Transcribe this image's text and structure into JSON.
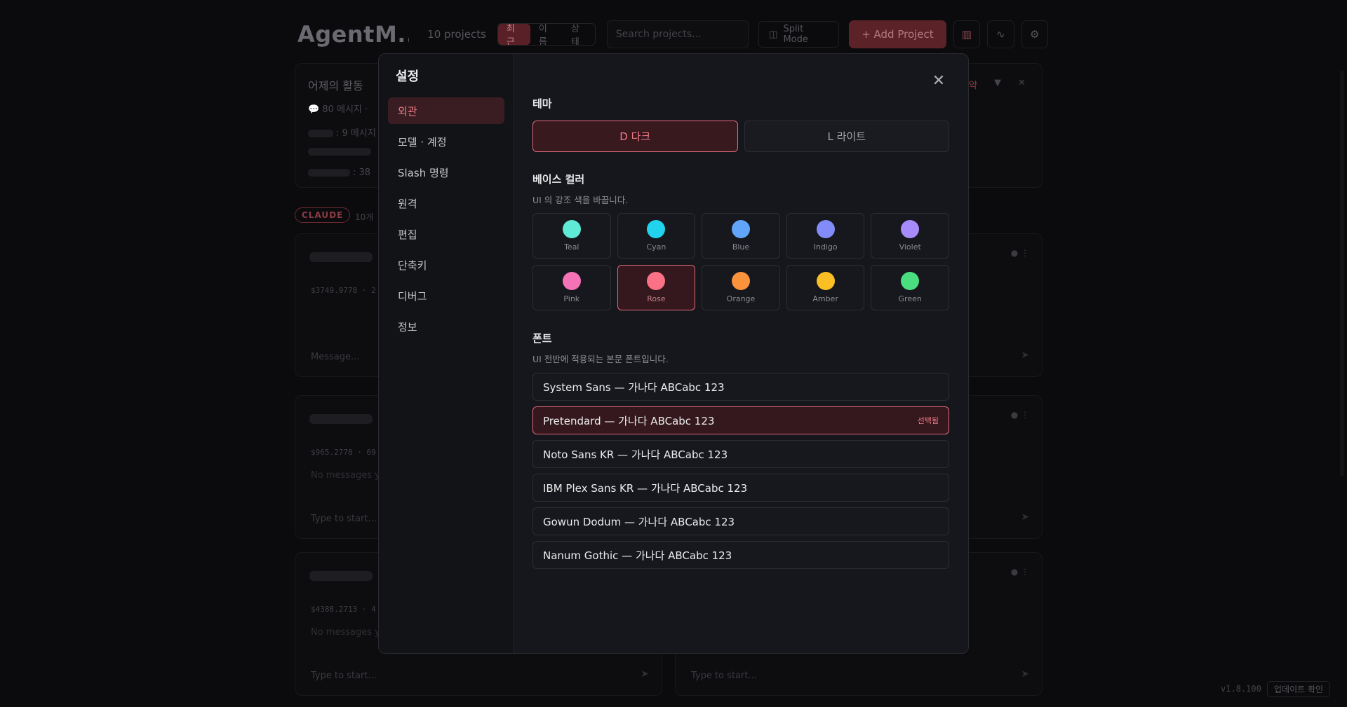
{
  "app": {
    "title": "AgentM...",
    "project_count": "10 projects",
    "sort_tabs": [
      {
        "label": "최근",
        "active": true
      },
      {
        "label": "이름",
        "active": false
      },
      {
        "label": "상태",
        "active": false
      }
    ],
    "search_placeholder": "Search projects...",
    "split_mode_label": "Split Mode",
    "add_project_label": "+ Add Project"
  },
  "activity": {
    "title": "어제의 활동",
    "summary": "💬 80 메시지 · ",
    "line1": ": 9 메시지",
    "line3": ": 38 ",
    "right_label": "약"
  },
  "claude_group": {
    "badge": "CLAUDE",
    "count": "10개"
  },
  "cards": [
    {
      "cost": "$3749.9778  ·  2",
      "input": "Message..."
    },
    {
      "cost": "$965.2778  ·  69",
      "nomsg": "No messages y",
      "input": "Type to start..."
    },
    {
      "cost": "$4388.2713  ·  4",
      "nomsg": "No messages y",
      "input": "Type to start..."
    },
    {
      "input": "Type to start..."
    }
  ],
  "footer": {
    "version": "v1.8.100",
    "update_label": "업데이트 확인"
  },
  "modal": {
    "title": "설정",
    "nav": [
      {
        "label": "외관",
        "active": true
      },
      {
        "label": "모델 · 계정",
        "active": false
      },
      {
        "label": "Slash 명령",
        "active": false
      },
      {
        "label": "원격",
        "active": false
      },
      {
        "label": "편집",
        "active": false
      },
      {
        "label": "단축키",
        "active": false
      },
      {
        "label": "디버그",
        "active": false
      },
      {
        "label": "정보",
        "active": false
      }
    ],
    "theme": {
      "title": "테마",
      "options": [
        {
          "label": "D  다크",
          "active": true
        },
        {
          "label": "L  라이트",
          "active": false
        }
      ]
    },
    "base_color": {
      "title": "베이스 컬러",
      "desc": "UI 의 강조 색을 바꿉니다.",
      "swatches": [
        {
          "label": "Teal",
          "color": "#5eead4",
          "active": false
        },
        {
          "label": "Cyan",
          "color": "#22d3ee",
          "active": false
        },
        {
          "label": "Blue",
          "color": "#60a5fa",
          "active": false
        },
        {
          "label": "Indigo",
          "color": "#818cf8",
          "active": false
        },
        {
          "label": "Violet",
          "color": "#a78bfa",
          "active": false
        },
        {
          "label": "Pink",
          "color": "#f472b6",
          "active": false
        },
        {
          "label": "Rose",
          "color": "#fb7185",
          "active": true
        },
        {
          "label": "Orange",
          "color": "#fb923c",
          "active": false
        },
        {
          "label": "Amber",
          "color": "#fbbf24",
          "active": false
        },
        {
          "label": "Green",
          "color": "#4ade80",
          "active": false
        }
      ]
    },
    "font": {
      "title": "폰트",
      "desc": "UI 전반에 적용되는 본문 폰트입니다.",
      "selected_badge": "선택됨",
      "options": [
        {
          "label": "System Sans — 가나다 ABCabc 123",
          "active": false
        },
        {
          "label": "Pretendard — 가나다 ABCabc 123",
          "active": true
        },
        {
          "label": "Noto Sans KR — 가나다 ABCabc 123",
          "active": false
        },
        {
          "label": "IBM Plex Sans KR — 가나다 ABCabc 123",
          "active": false
        },
        {
          "label": "Gowun Dodum — 가나다 ABCabc 123",
          "active": false
        },
        {
          "label": "Nanum Gothic — 가나다 ABCabc 123",
          "active": false
        }
      ]
    }
  }
}
